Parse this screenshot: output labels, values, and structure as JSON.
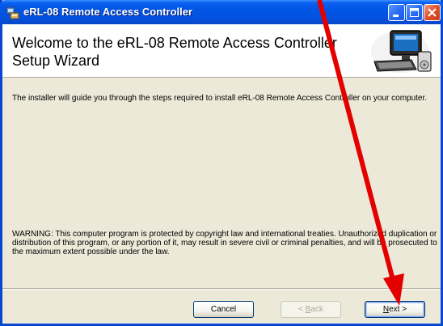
{
  "window": {
    "title": "eRL-08 Remote Access Controller"
  },
  "header": {
    "title": "Welcome to the eRL-08 Remote Access Controller Setup Wizard"
  },
  "body": {
    "intro": "The installer will guide you through the steps required to install eRL-08 Remote Access Controller on your computer.",
    "warning": "WARNING: This computer program is protected by copyright law and international treaties. Unauthorized duplication or distribution of this program, or any portion of it, may result in severe civil or criminal penalties, and will be prosecuted to the maximum extent possible under the law."
  },
  "buttons": {
    "cancel": "Cancel",
    "back_key": "B",
    "back_rest": "ack",
    "back_prefix": "< ",
    "next_key": "N",
    "next_rest": "ext",
    "next_suffix": " >"
  },
  "annotation": {
    "arrow_color": "#e50000"
  }
}
